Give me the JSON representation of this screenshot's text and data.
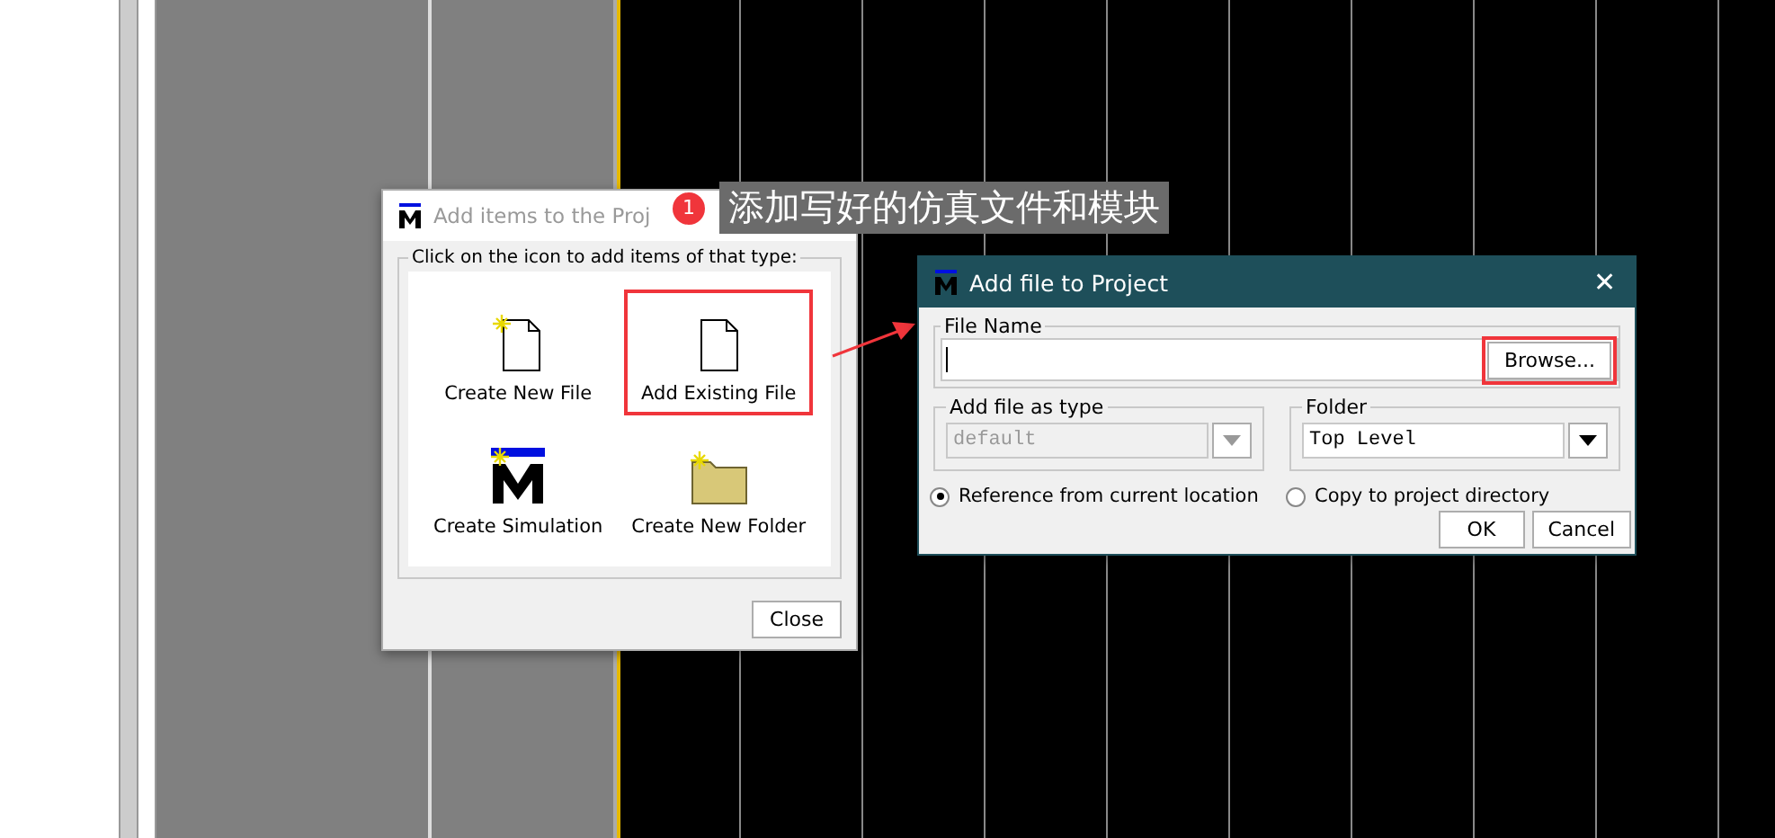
{
  "items_dialog": {
    "title": "Add items to the Proj",
    "active": false,
    "instruction": "Click on the icon to add items of that type:",
    "items": [
      {
        "label": "Create New File",
        "kind": "new-file",
        "highlighted": false
      },
      {
        "label": "Add Existing File",
        "kind": "file",
        "highlighted": true
      },
      {
        "label": "Create Simulation",
        "kind": "simulation",
        "highlighted": false
      },
      {
        "label": "Create New Folder",
        "kind": "folder",
        "highlighted": false
      }
    ],
    "close_button": "Close"
  },
  "callout": {
    "badge": "1",
    "text": "添加写好的仿真文件和模块"
  },
  "add_file_dialog": {
    "title": "Add file to Project",
    "active": true,
    "close_glyph": "✕",
    "file_name_label": "File Name",
    "browse_button": "Browse...",
    "browse_highlighted": true,
    "type_label": "Add file as type",
    "type_value": "default",
    "type_disabled": true,
    "folder_label": "Folder",
    "folder_value": "Top Level",
    "folder_disabled": false,
    "location_options": [
      {
        "label": "Reference from current location",
        "selected": true
      },
      {
        "label": "Copy to project directory",
        "selected": false
      }
    ],
    "buttons": [
      "OK",
      "Cancel"
    ]
  }
}
